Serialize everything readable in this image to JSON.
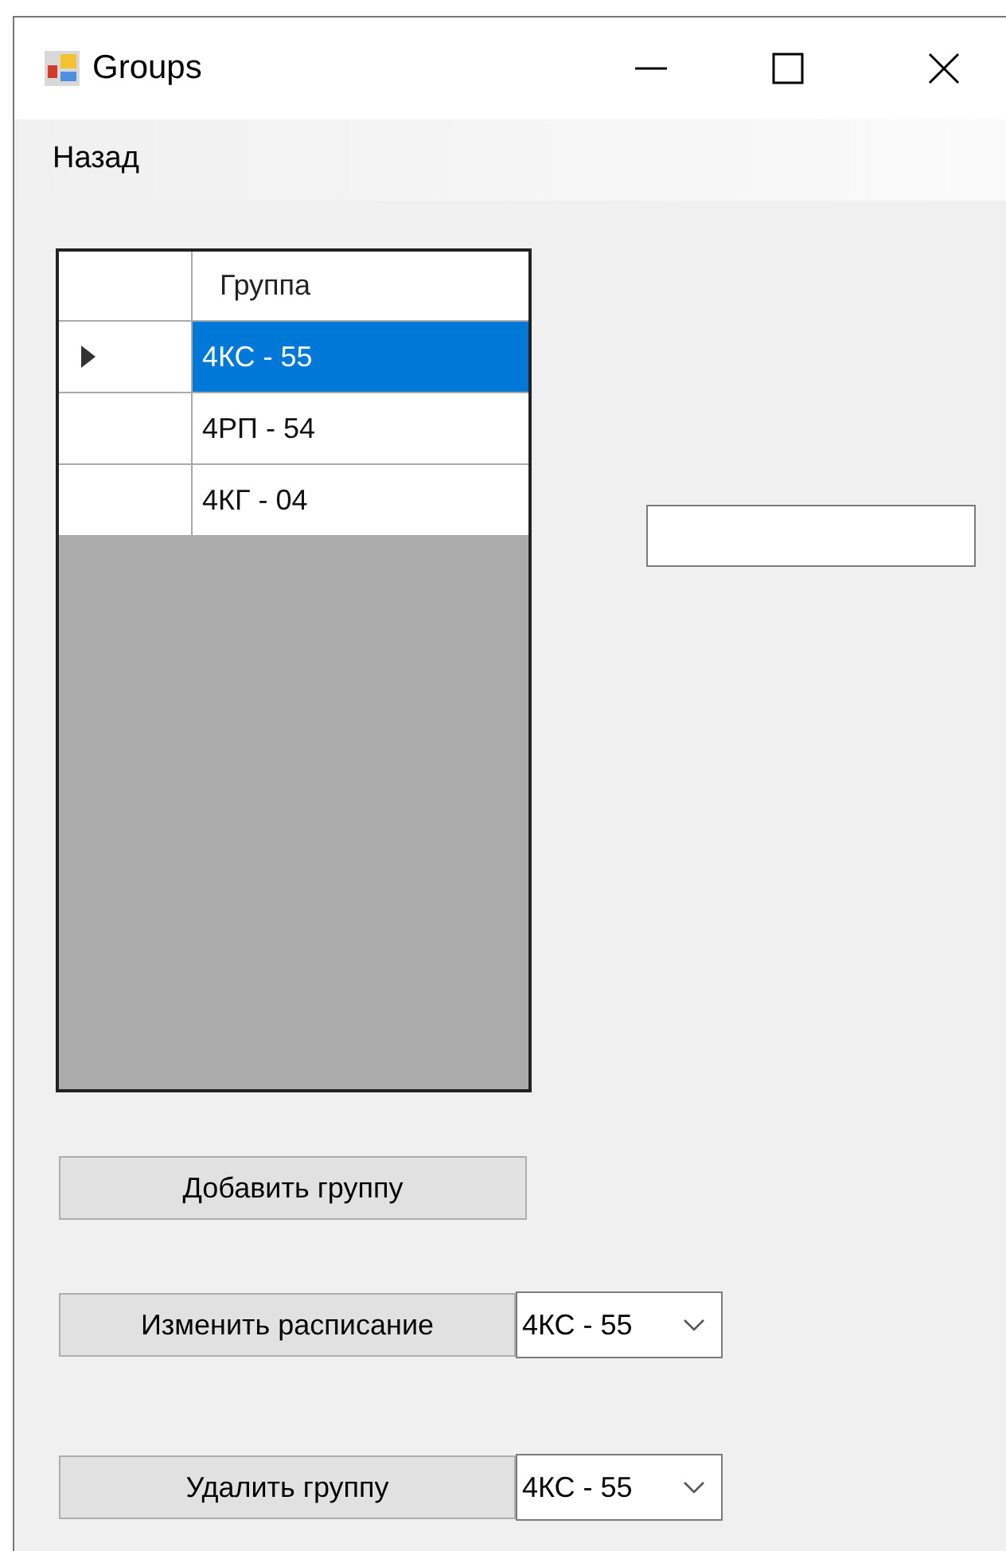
{
  "window": {
    "title": "Groups"
  },
  "menu": [
    {
      "label": "Назад"
    }
  ],
  "grid": {
    "columns": [
      "Группа"
    ],
    "rows": [
      {
        "cells": [
          "4КС - 55"
        ],
        "selected": true
      },
      {
        "cells": [
          "4РП - 54"
        ],
        "selected": false
      },
      {
        "cells": [
          "4КГ - 04"
        ],
        "selected": false
      }
    ]
  },
  "actions": [
    {
      "button": "Добавить группу"
    },
    {
      "button": "Изменить расписание",
      "combo": "4КС - 55"
    },
    {
      "button": "Удалить группу",
      "combo": "4КС - 55"
    }
  ]
}
